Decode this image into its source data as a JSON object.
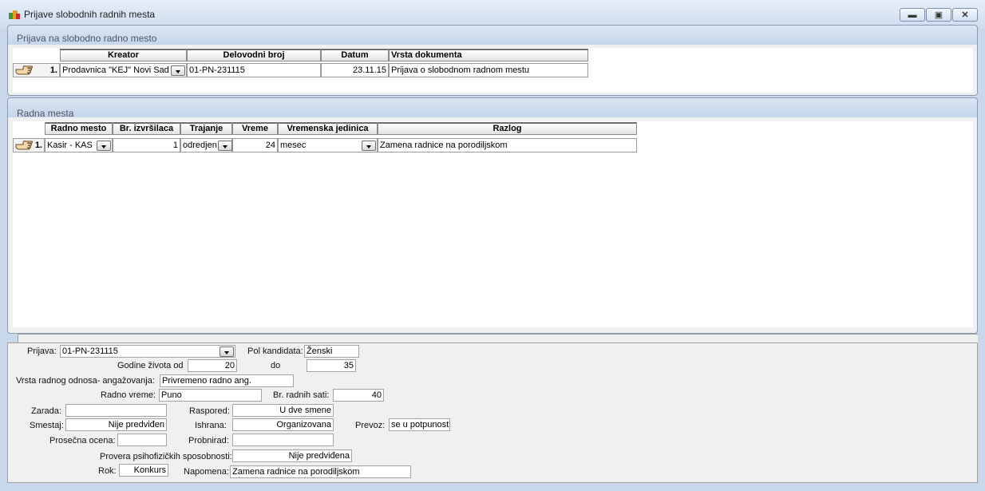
{
  "window": {
    "title": "Prijave slobodnih radnih mesta"
  },
  "prijava_panel": {
    "title": "Prijava na slobodno radno mesto",
    "columns": [
      "Kreator",
      "Delovodni broj",
      "Datum",
      "Vrsta dokumenta"
    ],
    "rows": [
      {
        "num": "1.",
        "kreator": "Prodavnica \"KEJ\" Novi Sad",
        "delovodni_broj": "01-PN-231115",
        "datum": "23.11.15",
        "vrsta_dokumenta": "Prijava o slobodnom radnom mestu"
      }
    ]
  },
  "radna_panel": {
    "title": "Radna mesta",
    "columns": [
      "Radno mesto",
      "Br. izvršilaca",
      "Trajanje",
      "Vreme",
      "Vremenska jedinica",
      "Razlog"
    ],
    "rows": [
      {
        "num": "1.",
        "radno_mesto": "Kasir - KAS",
        "br_izvrsilaca": "1",
        "trajanje": "odredjen",
        "vreme": "24",
        "vremenska_jedinica": "mesec",
        "razlog": "Zamena radnice na porodiljskom"
      }
    ]
  },
  "form": {
    "prijava_label": "Prijava:",
    "prijava_value": "01-PN-231115",
    "pol_label": "Pol kandidata:",
    "pol_value": "Ženski",
    "godine_label": "Godine života od",
    "godine_od": "20",
    "do_label": "do",
    "godine_do": "35",
    "vrsta_label": "Vrsta radnog odnosa- angažovanja:",
    "vrsta_value": "Privremeno radno ang.",
    "radno_vreme_label": "Radno vreme:",
    "radno_vreme_value": "Puno",
    "br_sati_label": "Br. radnih sati:",
    "br_sati_value": "40",
    "zarada_label": "Zarada:",
    "zarada_value": "",
    "raspored_label": "Raspored:",
    "raspored_value": "U dve smene",
    "smestaj_label": "Smestaj:",
    "smestaj_value": "Nije predviđen",
    "ishrana_label": "Ishrana:",
    "ishrana_value": "Organizovana",
    "prevoz_label": "Prevoz:",
    "prevoz_value": "se u potpunosti",
    "prosecna_label": "Prosečna ocena:",
    "prosecna_value": "",
    "probnirad_label": "Probnirad:",
    "probnirad_value": "",
    "provera_label": "Provera psihofizičkih sposobnosti:",
    "provera_value": "Nije predviđena",
    "rok_label": "Rok:",
    "rok_value": "Konkurs",
    "napomena_label": "Napomena:",
    "napomena_value": "Zamena radnice na porodiljskom"
  }
}
